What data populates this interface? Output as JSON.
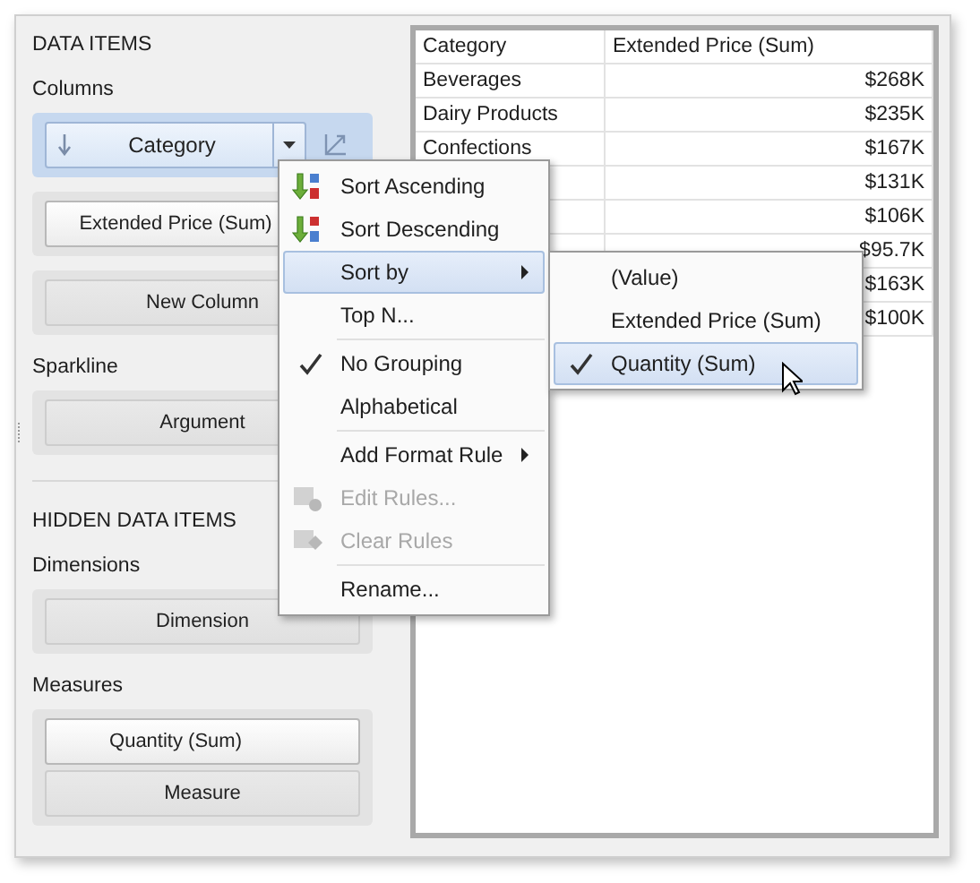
{
  "data_items": {
    "title": "DATA ITEMS",
    "sections": [
      {
        "label": "Columns",
        "groups": [
          {
            "selected": true,
            "items": [
              {
                "label": "Category",
                "kind": "active"
              }
            ]
          },
          {
            "selected": false,
            "items": [
              {
                "label": "Extended Price (Sum)",
                "kind": "item"
              }
            ]
          },
          {
            "selected": false,
            "items": [
              {
                "label": "New Column",
                "kind": "placeholder"
              }
            ]
          }
        ]
      },
      {
        "label": "Sparkline",
        "groups": [
          {
            "selected": false,
            "items": [
              {
                "label": "Argument",
                "kind": "placeholder"
              }
            ]
          }
        ]
      }
    ]
  },
  "hidden_data_items": {
    "title": "HIDDEN DATA ITEMS",
    "sections": [
      {
        "label": "Dimensions",
        "groups": [
          {
            "selected": false,
            "items": [
              {
                "label": "Dimension",
                "kind": "placeholder"
              }
            ]
          }
        ]
      },
      {
        "label": "Measures",
        "groups": [
          {
            "selected": false,
            "items": [
              {
                "label": "Quantity (Sum)",
                "kind": "item"
              },
              {
                "label": "Measure",
                "kind": "placeholder"
              }
            ]
          }
        ]
      }
    ]
  },
  "grid": {
    "columns": [
      "Category",
      "Extended Price (Sum)"
    ],
    "rows": [
      {
        "category": "Beverages",
        "value": "$268K"
      },
      {
        "category": "Dairy Products",
        "value": "$235K"
      },
      {
        "category": "Confections",
        "value": "$167K"
      },
      {
        "value": "$131K"
      },
      {
        "value": "$106K"
      },
      {
        "value": "$95.7K"
      },
      {
        "value": "$163K"
      },
      {
        "value": "$100K"
      }
    ]
  },
  "context_menu": {
    "groups": [
      [
        {
          "label": "Sort Ascending",
          "kind": "sort_ascending",
          "selected": false,
          "checked": false,
          "disabled": false,
          "submenu": false
        },
        {
          "label": "Sort Descending",
          "kind": "sort_descending",
          "selected": false,
          "checked": false,
          "disabled": false,
          "submenu": false
        },
        {
          "label": "Sort by",
          "kind": "plain",
          "selected": true,
          "checked": false,
          "disabled": false,
          "submenu": true
        },
        {
          "label": "Top N...",
          "kind": "plain",
          "selected": false,
          "checked": false,
          "disabled": false,
          "submenu": false
        }
      ],
      [
        {
          "label": "No Grouping",
          "kind": "plain",
          "selected": false,
          "checked": true,
          "disabled": false,
          "submenu": false
        },
        {
          "label": "Alphabetical",
          "kind": "plain",
          "selected": false,
          "checked": false,
          "disabled": false,
          "submenu": false
        }
      ],
      [
        {
          "label": "Add Format Rule",
          "kind": "plain",
          "selected": false,
          "checked": false,
          "disabled": false,
          "submenu": true
        },
        {
          "label": "Edit Rules...",
          "kind": "edit_rules",
          "selected": false,
          "checked": false,
          "disabled": true,
          "submenu": false
        },
        {
          "label": "Clear Rules",
          "kind": "clear_rules",
          "selected": false,
          "checked": false,
          "disabled": true,
          "submenu": false
        }
      ],
      [
        {
          "label": "Rename...",
          "kind": "plain",
          "selected": false,
          "checked": false,
          "disabled": false,
          "submenu": false
        }
      ]
    ]
  },
  "sort_by_submenu": {
    "items": [
      {
        "label": "(Value)",
        "checked": false,
        "selected": false
      },
      {
        "label": "Extended Price (Sum)",
        "checked": false,
        "selected": false
      },
      {
        "label": "Quantity (Sum)",
        "checked": true,
        "selected": true
      }
    ]
  }
}
